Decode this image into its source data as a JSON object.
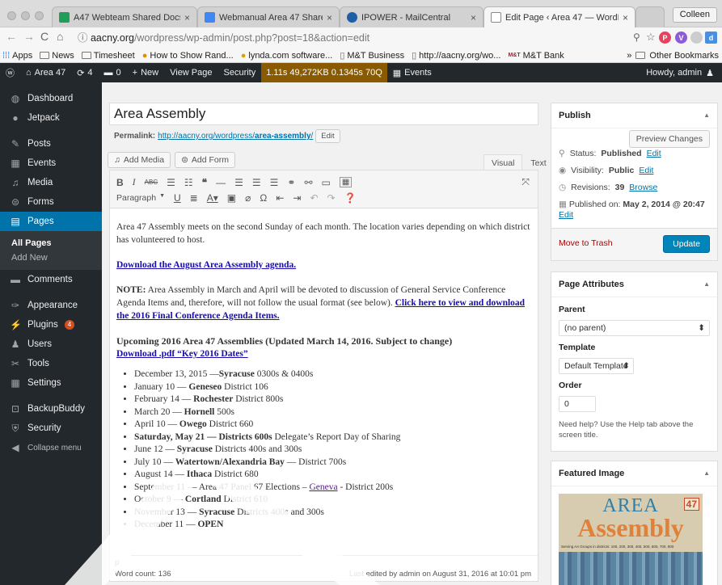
{
  "browser": {
    "tabs": [
      {
        "title": "A47 Webteam Shared Docs - ",
        "color": "#1f9e5a"
      },
      {
        "title": "Webmanual Area 47 Shared D",
        "color": "#4285f4"
      },
      {
        "title": "IPOWER - MailCentral",
        "color": "#1c5fa8"
      },
      {
        "title": "Edit Page ‹ Area 47 — WordP",
        "color": "#777777"
      }
    ],
    "profile": "Colleen",
    "url_host": "aacny.org",
    "url_path": "/wordpress/wp-admin/post.php?post=18&action=edit",
    "bookmarks": [
      "Apps",
      "News",
      "Timesheet",
      "How to Show Rand...",
      "lynda.com software...",
      "M&T Business",
      "http://aacny.org/wo...",
      "M&T Bank"
    ],
    "bookmarks_more": "»",
    "other_bookmarks": "Other Bookmarks"
  },
  "adminbar": {
    "site": "Area 47",
    "updates": "4",
    "comments": "0",
    "new": "New",
    "view": "View Page",
    "security": "Security",
    "perf": "1.11s  49,272KB  0.1345s  70Q",
    "events": "Events",
    "howdy": "Howdy, admin"
  },
  "sidebar": {
    "items": [
      {
        "label": "Dashboard",
        "icon": "◍"
      },
      {
        "label": "Jetpack",
        "icon": "●"
      },
      {
        "label": "Posts",
        "icon": "✎"
      },
      {
        "label": "Events",
        "icon": "▦"
      },
      {
        "label": "Media",
        "icon": "♫"
      },
      {
        "label": "Forms",
        "icon": "⊜"
      },
      {
        "label": "Pages",
        "icon": "▤"
      },
      {
        "label": "Comments",
        "icon": "▬"
      },
      {
        "label": "Appearance",
        "icon": "✑"
      },
      {
        "label": "Plugins",
        "icon": "⚡",
        "badge": "4"
      },
      {
        "label": "Users",
        "icon": "♟"
      },
      {
        "label": "Tools",
        "icon": "✂"
      },
      {
        "label": "Settings",
        "icon": "▦"
      },
      {
        "label": "BackupBuddy",
        "icon": "⊡"
      },
      {
        "label": "Security",
        "icon": "⛨"
      },
      {
        "label": "Collapse menu",
        "icon": "◀"
      }
    ],
    "sub": [
      "All Pages",
      "Add New"
    ]
  },
  "editor": {
    "title": "Area Assembly",
    "permalink_label": "Permalink:",
    "permalink_base": "http://aacny.org/wordpress/",
    "permalink_slug": "area-assembly",
    "permalink_end": "/",
    "edit": "Edit",
    "add_media": "Add Media",
    "add_form": "Add Form",
    "tab_visual": "Visual",
    "tab_text": "Text",
    "format": "Paragraph",
    "p1": "Area 47 Assembly meets on the second Sunday of each month. The location varies depending on which district has volunteered to host.",
    "link1": "Download the August Area Assembly agenda.",
    "note_label": "NOTE:",
    "note_text": " Area Assembly in March and April will be devoted to discussion of General Service Conference Agenda Items and, therefore, will not follow the usual format (see below). ",
    "note_link": "Click here to view and download the 2016 Final Conference Agenda Items.",
    "heading": "Upcoming 2016 Area 47 Assemblies (Updated March 14, 2016. Subject to change)",
    "heading_link": "Download .pdf “Key 2016 Dates”",
    "list": [
      [
        "December 13, 2015 —",
        "Syracuse",
        " 0300s & 0400s"
      ],
      [
        "January 10 — ",
        "Geneseo",
        " District 106"
      ],
      [
        "February 14 — ",
        "Rochester",
        " District 800s"
      ],
      [
        "March 20 — ",
        "Hornell",
        " 500s"
      ],
      [
        "April 10 — ",
        "Owego",
        " District 660"
      ],
      [
        "",
        "Saturday, May 21 — Districts 600s",
        " Delegate’s Report Day of Sharing"
      ],
      [
        "June 12 — ",
        "Syracuse",
        " Districts 400s and 300s"
      ],
      [
        "July 10 — ",
        "Watertown/Alexandria Bay",
        " — District 700s"
      ],
      [
        "August 14 — ",
        "Ithaca",
        " District 680"
      ],
      [
        "September 11 — Area 47 Panel 67 Elections – ",
        "Geneva",
        " - District 200s"
      ],
      [
        "October 9 — ",
        "Cortland",
        " District 610"
      ],
      [
        "November 13 — ",
        "Syracuse",
        " Districts 400s and 300s"
      ],
      [
        "December 11 — ",
        "OPEN",
        ""
      ]
    ],
    "path": "p",
    "word_count": "Word count: 136",
    "last_edited": "Last edited by admin on August 31, 2016 at 10:01 pm"
  },
  "publish": {
    "title": "Publish",
    "preview": "Preview Changes",
    "status_label": "Status:",
    "status": "Published",
    "visibility_label": "Visibility:",
    "visibility": "Public",
    "revisions_label": "Revisions:",
    "revisions": "39",
    "browse": "Browse",
    "published_label": "Published on:",
    "published": "May 2, 2014 @ 20:47",
    "edit": "Edit",
    "trash": "Move to Trash",
    "update": "Update"
  },
  "attributes": {
    "title": "Page Attributes",
    "parent_label": "Parent",
    "parent": "(no parent)",
    "template_label": "Template",
    "template": "Default Template",
    "order_label": "Order",
    "order": "0",
    "help": "Need help? Use the Help tab above the screen title."
  },
  "featured": {
    "title": "Featured Image",
    "img_line1": "AREA",
    "img_line2": "Assembly",
    "img_num": "47",
    "img_sub": "Serving AA Groups in districts: 100, 200, 300, 400, 500, 600, 700, 800"
  },
  "colors": {
    "accent": "#0073aa",
    "admin_dark": "#23282d",
    "trash": "#a00000"
  }
}
